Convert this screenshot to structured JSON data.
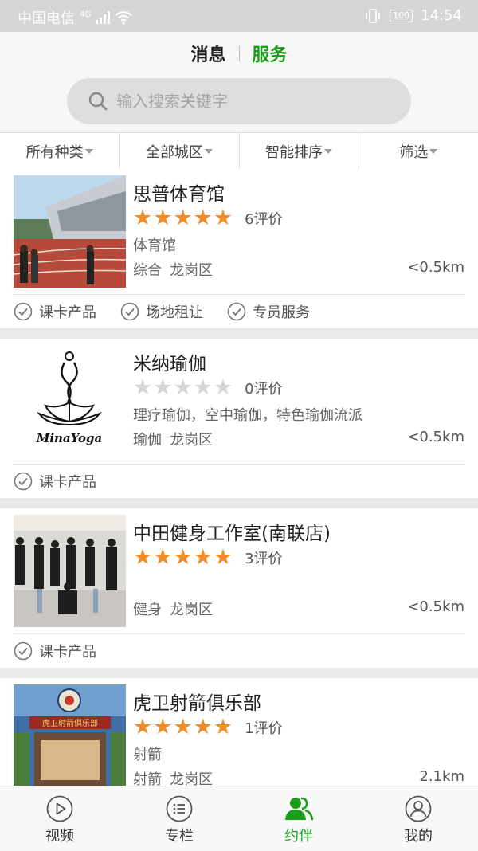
{
  "status_bar": {
    "carrier": "中国电信",
    "network": "4G",
    "battery": "100",
    "time": "14:54"
  },
  "header": {
    "tabs": [
      {
        "label": "消息",
        "active": false
      },
      {
        "label": "服务",
        "active": true
      }
    ],
    "search_placeholder": "输入搜索关键字"
  },
  "filters": [
    {
      "label": "所有种类"
    },
    {
      "label": "全部城区"
    },
    {
      "label": "智能排序"
    },
    {
      "label": "筛选"
    }
  ],
  "venues": [
    {
      "name": "思普体育馆",
      "rating": 5,
      "reviews": "6评价",
      "category": "体育馆",
      "tags": [
        "综合",
        "龙岗区"
      ],
      "distance": "<0.5km",
      "services": [
        "课卡产品",
        "场地租让",
        "专员服务"
      ]
    },
    {
      "name": "米纳瑜伽",
      "rating": 0,
      "reviews": "0评价",
      "category": "理疗瑜伽，空中瑜伽，特色瑜伽流派",
      "tags": [
        "瑜伽",
        "龙岗区"
      ],
      "distance": "<0.5km",
      "services": [
        "课卡产品"
      ],
      "logo_text": "MinaYoga"
    },
    {
      "name": "中田健身工作室(南联店)",
      "rating": 5,
      "reviews": "3评价",
      "category": "",
      "tags": [
        "健身",
        "龙岗区"
      ],
      "distance": "<0.5km",
      "services": [
        "课卡产品"
      ]
    },
    {
      "name": "虎卫射箭俱乐部",
      "rating": 5,
      "reviews": "1评价",
      "category": "射箭",
      "tags": [
        "射箭",
        "龙岗区"
      ],
      "distance": "2.1km",
      "services": [],
      "sign_text": "虎卫射箭俱乐部"
    }
  ],
  "bottom_nav": [
    {
      "label": "视频",
      "icon": "play-circle-icon",
      "active": false
    },
    {
      "label": "专栏",
      "icon": "list-circle-icon",
      "active": false
    },
    {
      "label": "约伴",
      "icon": "people-icon",
      "active": true
    },
    {
      "label": "我的",
      "icon": "user-circle-icon",
      "active": false
    }
  ],
  "colors": {
    "accent": "#1a9e1a",
    "star": "#f08c2a",
    "star_off": "#d5d5d5"
  }
}
